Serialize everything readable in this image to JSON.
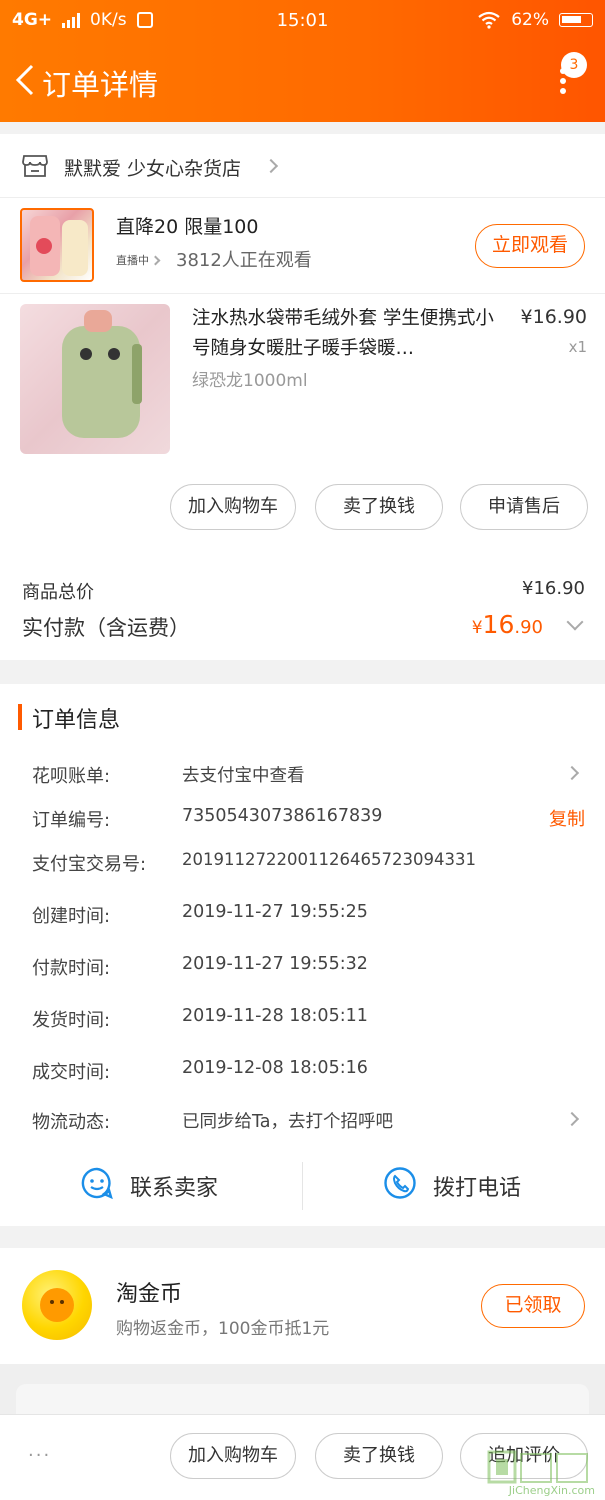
{
  "status_bar": {
    "network": "4G+",
    "speed": "0K/s",
    "time": "15:01",
    "battery": "62%"
  },
  "nav": {
    "title": "订单详情",
    "badge": "3"
  },
  "shop": {
    "name": "默默爱 少女心杂货店"
  },
  "live": {
    "title": "直降20 限量100",
    "tag": "直播中",
    "watching": "3812人正在观看",
    "button": "立即观看"
  },
  "product": {
    "title": "注水热水袋带毛绒外套 学生便携式小号随身女暖肚子暖手袋暖…",
    "price": "¥16.90",
    "qty": "x1",
    "spec": "绿恐龙1000ml"
  },
  "product_actions": [
    "加入购物车",
    "卖了换钱",
    "申请售后"
  ],
  "totals": {
    "goods_label": "商品总价",
    "goods_value": "¥16.90",
    "paid_label": "实付款（含运费）",
    "paid_currency": "¥",
    "paid_int": "16",
    "paid_dec": ".90"
  },
  "order_info": {
    "title": "订单信息",
    "rows": [
      {
        "label": "花呗账单:",
        "value": "去支付宝中查看"
      },
      {
        "label": "订单编号:",
        "value": "735054307386167839"
      },
      {
        "label": "支付宝交易号:",
        "value": "2019112722001126465723094331"
      },
      {
        "label": "创建时间:",
        "value": "2019-11-27 19:55:25"
      },
      {
        "label": "付款时间:",
        "value": "2019-11-27 19:55:32"
      },
      {
        "label": "发货时间:",
        "value": "2019-11-28 18:05:11"
      },
      {
        "label": "成交时间:",
        "value": "2019-12-08 18:05:16"
      },
      {
        "label": "物流动态:",
        "value": "已同步给Ta，去打个招呼吧"
      }
    ],
    "copy": "复制"
  },
  "contact": {
    "seller": "联系卖家",
    "phone": "拨打电话"
  },
  "coin": {
    "name": "淘金币",
    "desc": "购物返金币，100金币抵1元",
    "button": "已领取"
  },
  "bottom": {
    "ellipsis": "···",
    "buttons": [
      "加入购物车",
      "卖了换钱",
      "追加评价"
    ]
  },
  "watermark": {
    "text": "JiChengXin.com"
  },
  "colors": {
    "brand_orange": "#ff6a00",
    "price_orange": "#ff5a00"
  }
}
